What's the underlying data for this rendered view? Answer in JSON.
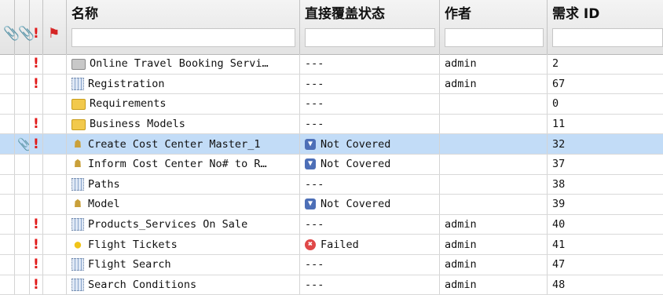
{
  "columns": {
    "attachment_icon": "paperclip-icon",
    "priority_icon": "exclamation-icon",
    "flag_icon": "flag-icon",
    "name": "名称",
    "coverage": "直接覆盖状态",
    "author": "作者",
    "req_id": "需求 ID"
  },
  "rows": [
    {
      "attach": "",
      "priority": "!",
      "icon": "folder-gray",
      "name": "Online Travel Booking Servi…",
      "status_icon": "",
      "coverage": "---",
      "author": "admin",
      "id": "2"
    },
    {
      "attach": "",
      "priority": "!",
      "icon": "requirement",
      "name": "Registration",
      "status_icon": "",
      "coverage": "---",
      "author": "admin",
      "id": "67"
    },
    {
      "attach": "",
      "priority": "",
      "icon": "folder",
      "name": "Requirements",
      "status_icon": "",
      "coverage": "---",
      "author": "",
      "id": "0"
    },
    {
      "attach": "",
      "priority": "!",
      "icon": "folder",
      "name": "Business Models",
      "status_icon": "",
      "coverage": "---",
      "author": "",
      "id": "11"
    },
    {
      "attach": "📎",
      "priority": "!",
      "icon": "model",
      "name": "Create Cost Center Master_1",
      "status_icon": "not-covered",
      "coverage": "Not Covered",
      "author": "",
      "id": "32",
      "selected": true
    },
    {
      "attach": "",
      "priority": "",
      "icon": "model",
      "name": "Inform Cost Center No# to R…",
      "status_icon": "not-covered",
      "coverage": "Not Covered",
      "author": "",
      "id": "37"
    },
    {
      "attach": "",
      "priority": "",
      "icon": "requirement",
      "name": "Paths",
      "status_icon": "",
      "coverage": "---",
      "author": "",
      "id": "38"
    },
    {
      "attach": "",
      "priority": "",
      "icon": "model",
      "name": "Model",
      "status_icon": "not-covered",
      "coverage": "Not Covered",
      "author": "",
      "id": "39"
    },
    {
      "attach": "",
      "priority": "!",
      "icon": "requirement",
      "name": "Products_Services On Sale",
      "status_icon": "",
      "coverage": "---",
      "author": "admin",
      "id": "40"
    },
    {
      "attach": "",
      "priority": "!",
      "icon": "bulb",
      "name": "Flight Tickets",
      "status_icon": "failed",
      "coverage": "Failed",
      "author": "admin",
      "id": "41"
    },
    {
      "attach": "",
      "priority": "!",
      "icon": "requirement",
      "name": "Flight Search",
      "status_icon": "",
      "coverage": "---",
      "author": "admin",
      "id": "47"
    },
    {
      "attach": "",
      "priority": "!",
      "icon": "requirement",
      "name": "Search Conditions",
      "status_icon": "",
      "coverage": "---",
      "author": "admin",
      "id": "48"
    }
  ],
  "colors": {
    "selected_row": "#c2dcf7",
    "priority": "#e01b1b",
    "not_covered": "#4d6fb7",
    "failed": "#e04848"
  }
}
